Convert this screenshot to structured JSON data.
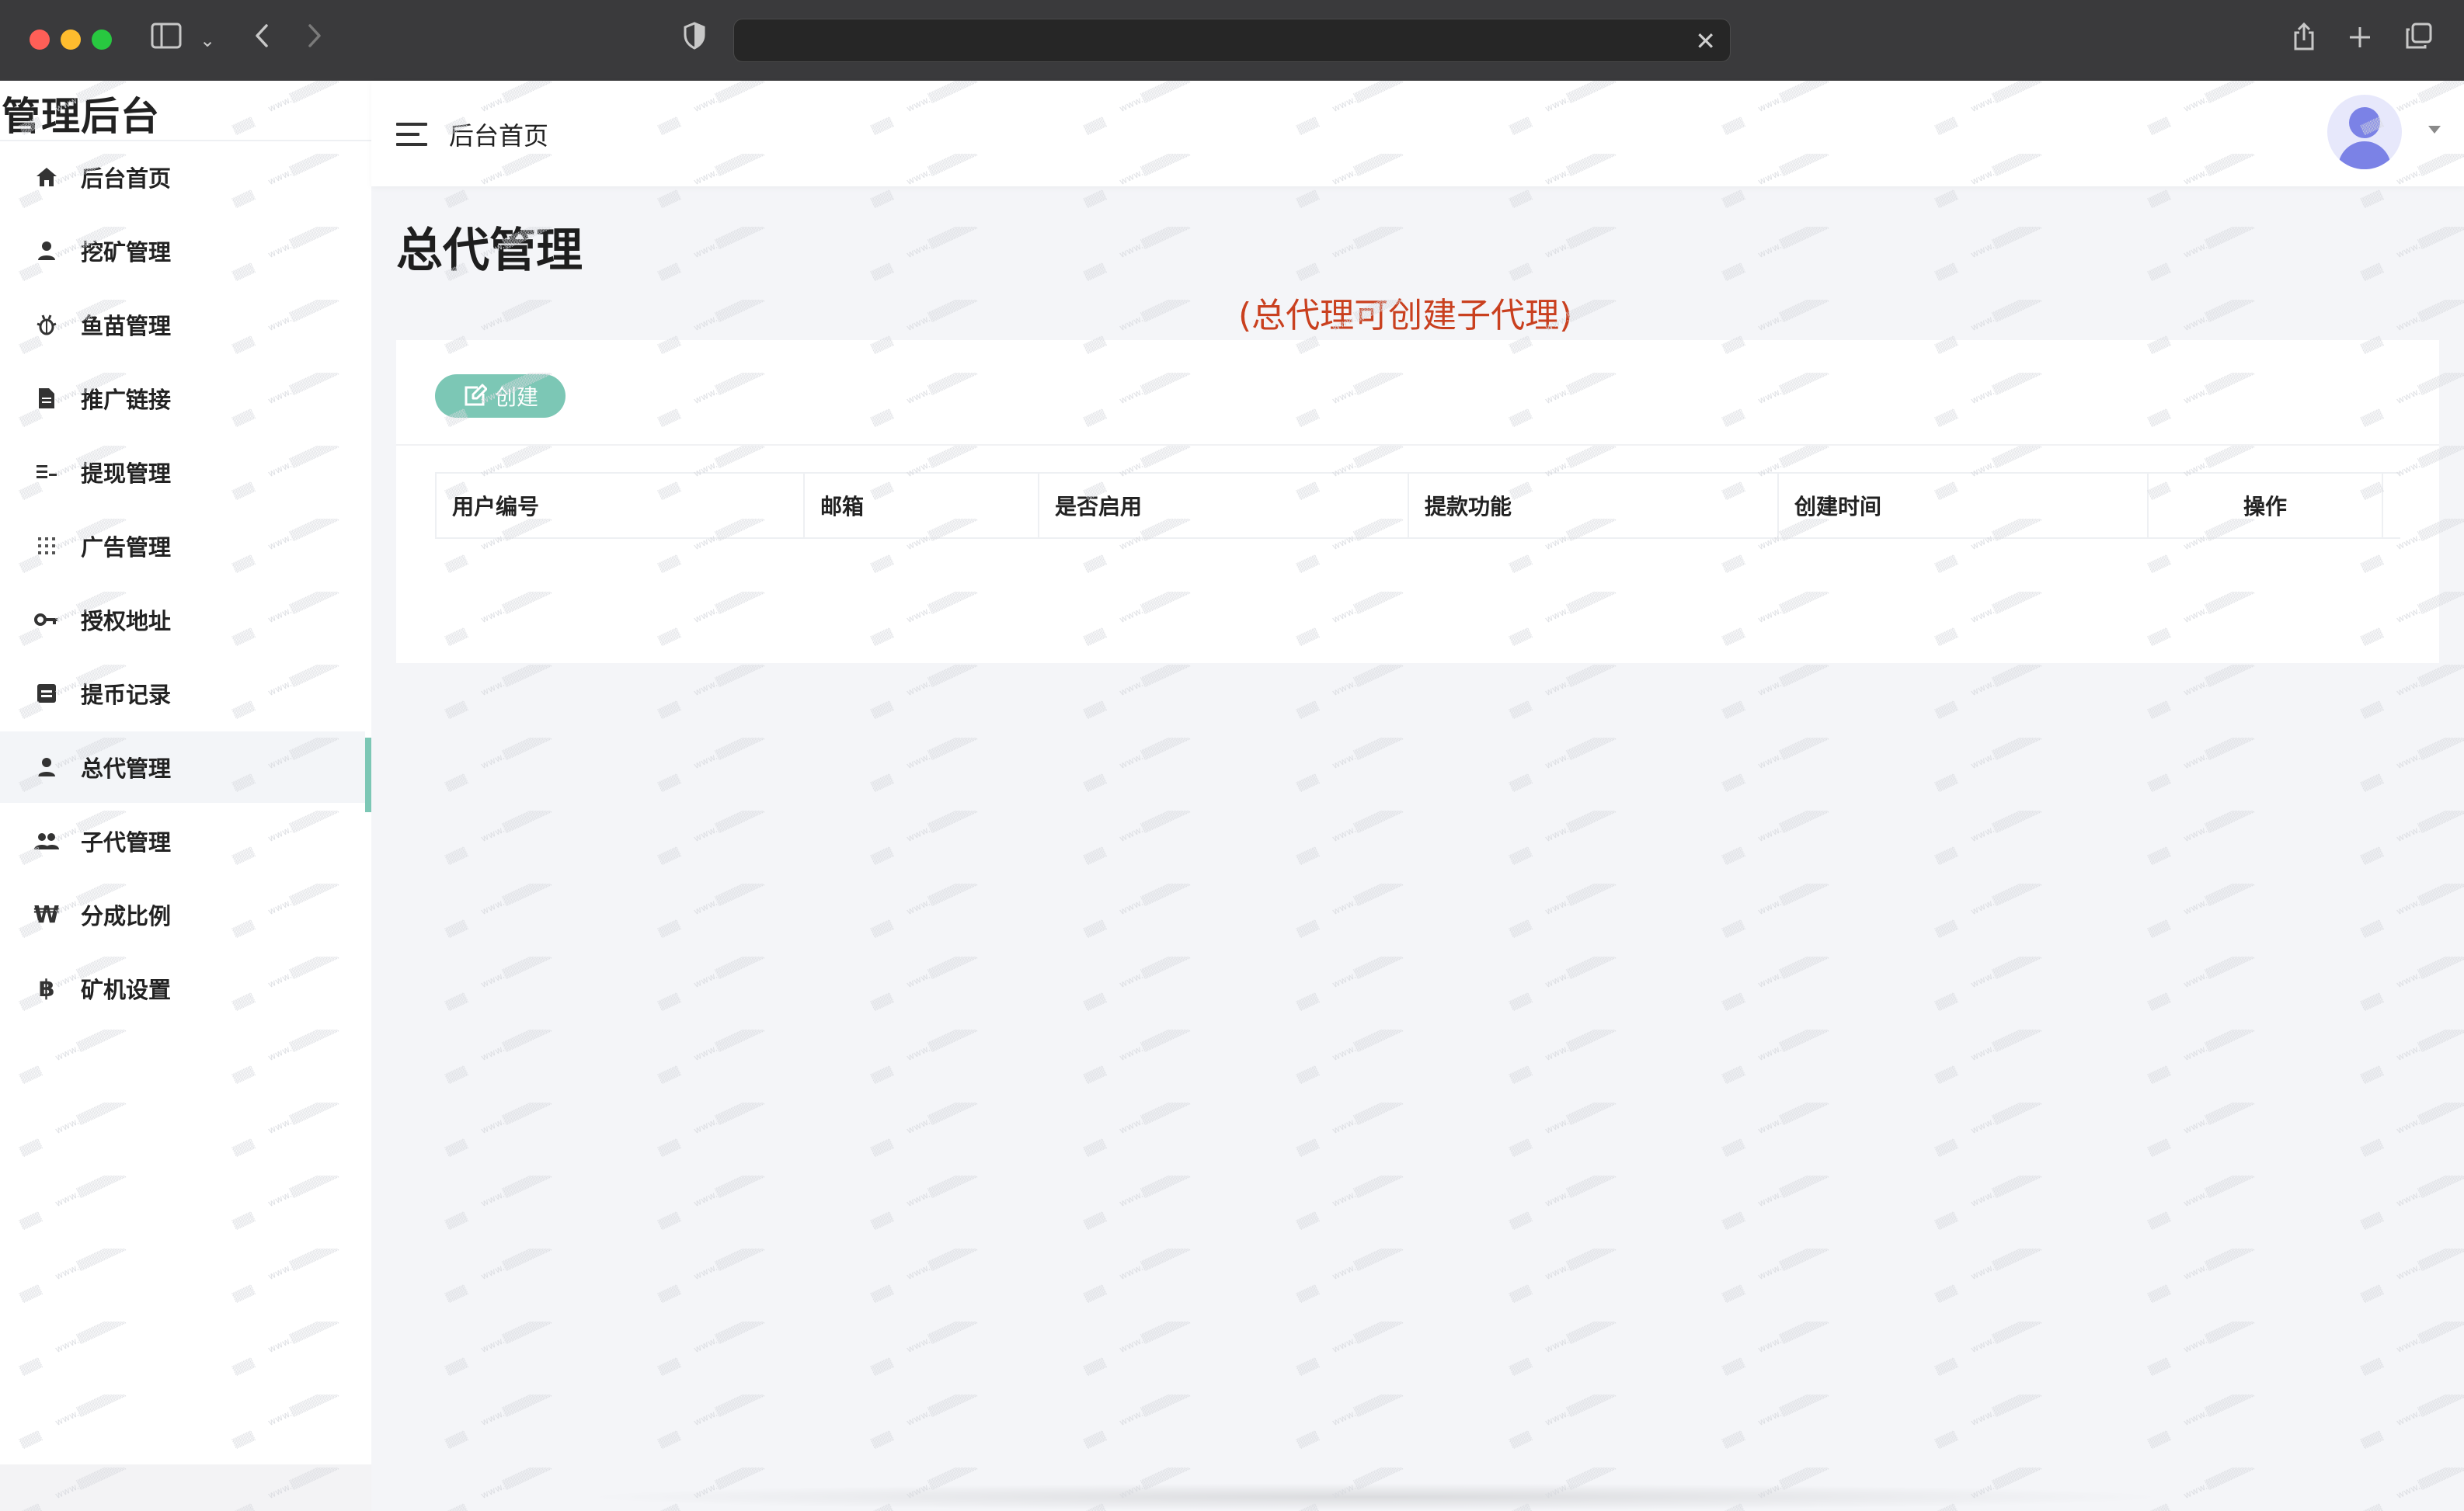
{
  "brand": "管理后台",
  "header": {
    "title": "后台首页"
  },
  "sidebar": {
    "items": [
      {
        "label": "后台首页",
        "icon": "home-icon"
      },
      {
        "label": "挖矿管理",
        "icon": "user-icon"
      },
      {
        "label": "鱼苗管理",
        "icon": "bug-icon"
      },
      {
        "label": "推广链接",
        "icon": "document-icon"
      },
      {
        "label": "提现管理",
        "icon": "list-icon"
      },
      {
        "label": "广告管理",
        "icon": "grid-icon"
      },
      {
        "label": "授权地址",
        "icon": "key-icon"
      },
      {
        "label": "提币记录",
        "icon": "card-icon"
      },
      {
        "label": "总代管理",
        "icon": "user-icon"
      },
      {
        "label": "子代管理",
        "icon": "users-icon"
      },
      {
        "label": "分成比例",
        "icon": "won-icon"
      },
      {
        "label": "矿机设置",
        "icon": "bitcoin-icon"
      }
    ],
    "active_index": 8
  },
  "page": {
    "title": "总代管理",
    "note": "(总代理可创建子代理)",
    "create_label": "创建"
  },
  "table": {
    "columns": [
      "用户编号",
      "邮箱",
      "是否启用",
      "提款功能",
      "创建时间",
      "操作"
    ],
    "rows": []
  },
  "colors": {
    "accent": "#7cc7b5",
    "note": "#c9401f",
    "avatar": "#7b82e6"
  }
}
